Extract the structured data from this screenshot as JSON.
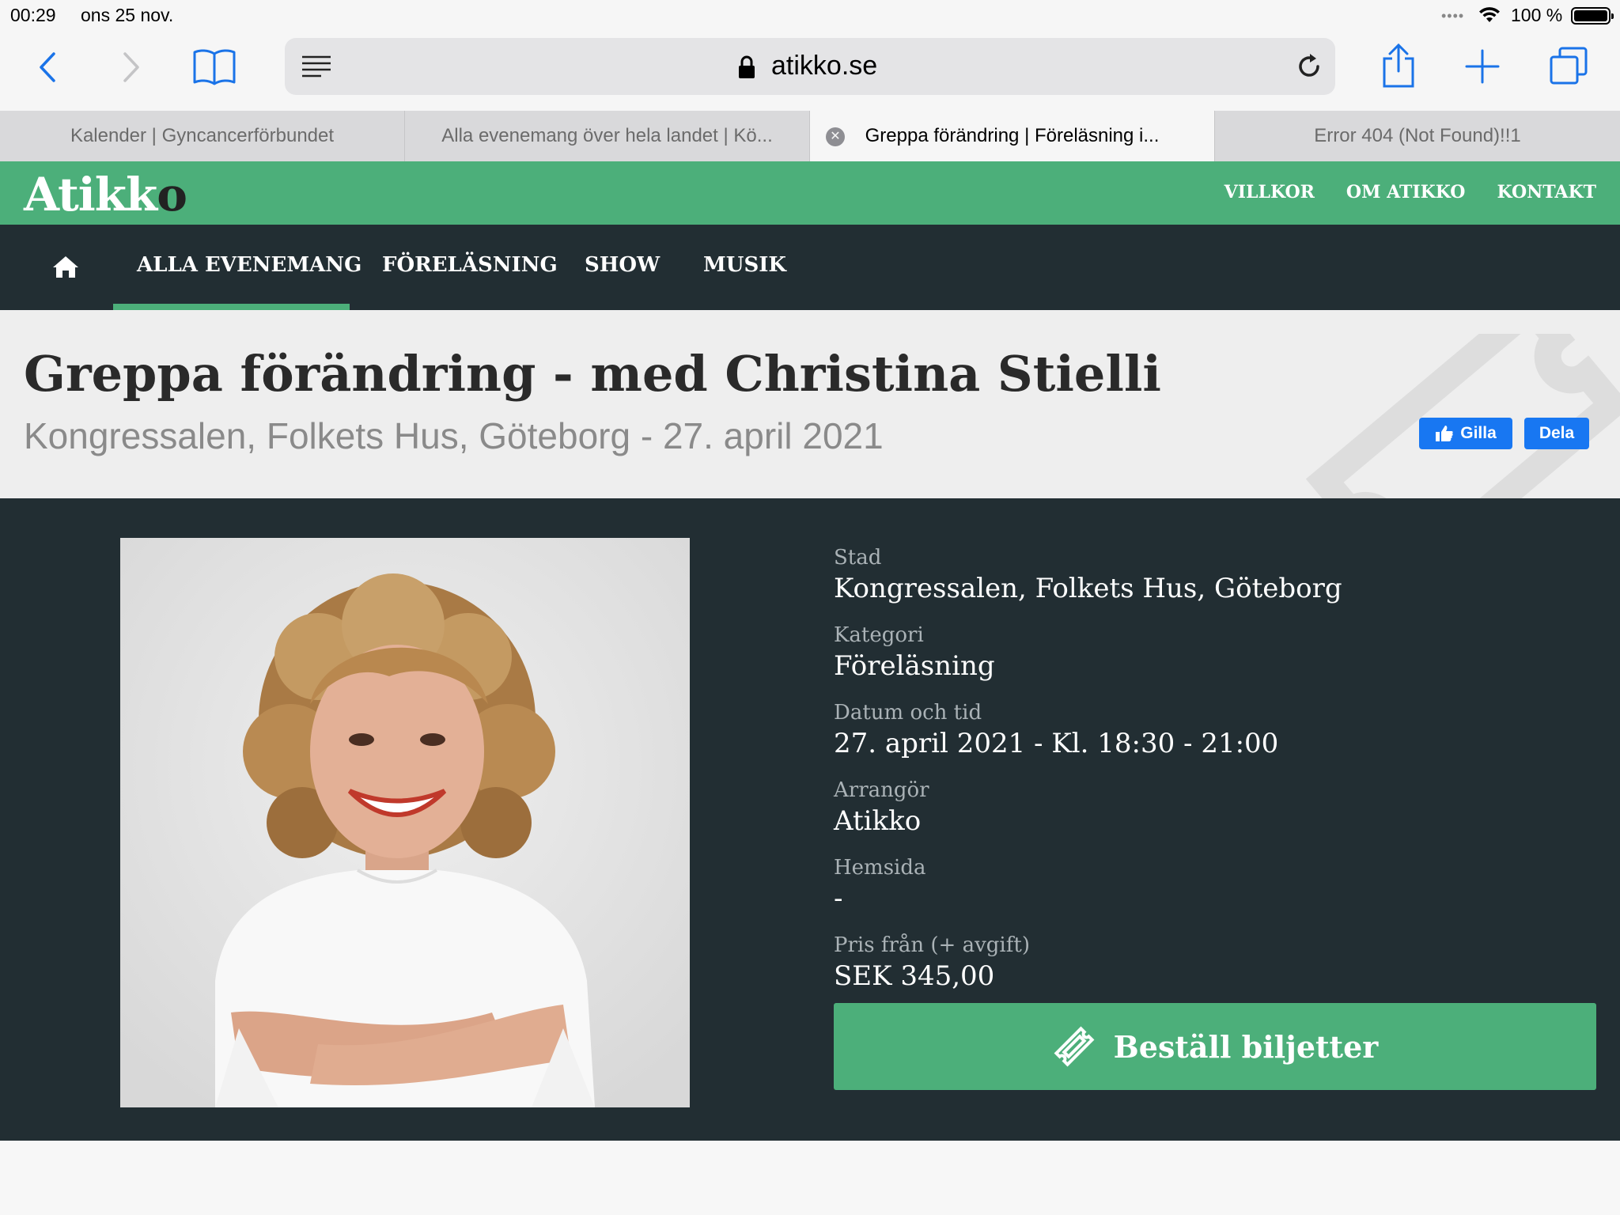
{
  "status_bar": {
    "time": "00:29",
    "date": "ons 25 nov.",
    "battery_percent": "100 %",
    "battery_level": 1.0
  },
  "browser": {
    "url": "atikko.se",
    "tabs": [
      {
        "title": "Kalender | Gyncancerförbundet",
        "active": false
      },
      {
        "title": "Alla evenemang över hela landet | Kö...",
        "active": false
      },
      {
        "title": "Greppa förändring | Föreläsning i...",
        "active": true
      },
      {
        "title": "Error 404 (Not Found)!!1",
        "active": false
      }
    ]
  },
  "site": {
    "logo_main": "Atikk",
    "logo_tail": "o",
    "top_links": [
      "VILLKOR",
      "OM ATIKKO",
      "KONTAKT"
    ],
    "main_nav": [
      "ALLA EVENEMANG",
      "FÖRELÄSNING",
      "SHOW",
      "MUSIK"
    ],
    "active_nav": "ALLA EVENEMANG",
    "brand_color": "#4caf7a",
    "dark_color": "#222e33"
  },
  "event": {
    "title": "Greppa förändring - med Christina Stielli",
    "subtitle": "Kongressalen, Folkets Hus, Göteborg - 27. april 2021",
    "like_label": "Gilla",
    "share_label": "Dela",
    "fields": [
      {
        "label": "Stad",
        "value": "Kongressalen, Folkets Hus, Göteborg"
      },
      {
        "label": "Kategori",
        "value": "Föreläsning"
      },
      {
        "label": "Datum och tid",
        "value": "27. april 2021 - Kl. 18:30 - 21:00"
      },
      {
        "label": "Arrangör",
        "value": "Atikko"
      },
      {
        "label": "Hemsida",
        "value": "-"
      },
      {
        "label": "Pris från (+ avgift)",
        "value": "SEK 345,00"
      }
    ],
    "buy_label": "Beställ biljetter"
  }
}
